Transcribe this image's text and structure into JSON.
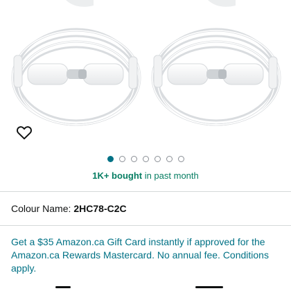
{
  "product_gallery": {
    "image_description_icon": "usb-c-cable-coils-image",
    "wishlist_icon": "heart-outline-icon",
    "dots_total": 7,
    "active_dot_index": 0
  },
  "social_proof": {
    "count": "1K+ bought",
    "suffix": " in past month"
  },
  "variant": {
    "label": "Colour Name:",
    "value": "2HC78-C2C"
  },
  "promo": {
    "text": "Get a $35 Amazon.ca Gift Card instantly if approved for the Amazon.ca Rewards Mastercard. No annual fee. Conditions apply."
  },
  "colors": {
    "accent_teal": "#007185",
    "bought_green": "#067d62",
    "divider": "#d5d9d9"
  }
}
